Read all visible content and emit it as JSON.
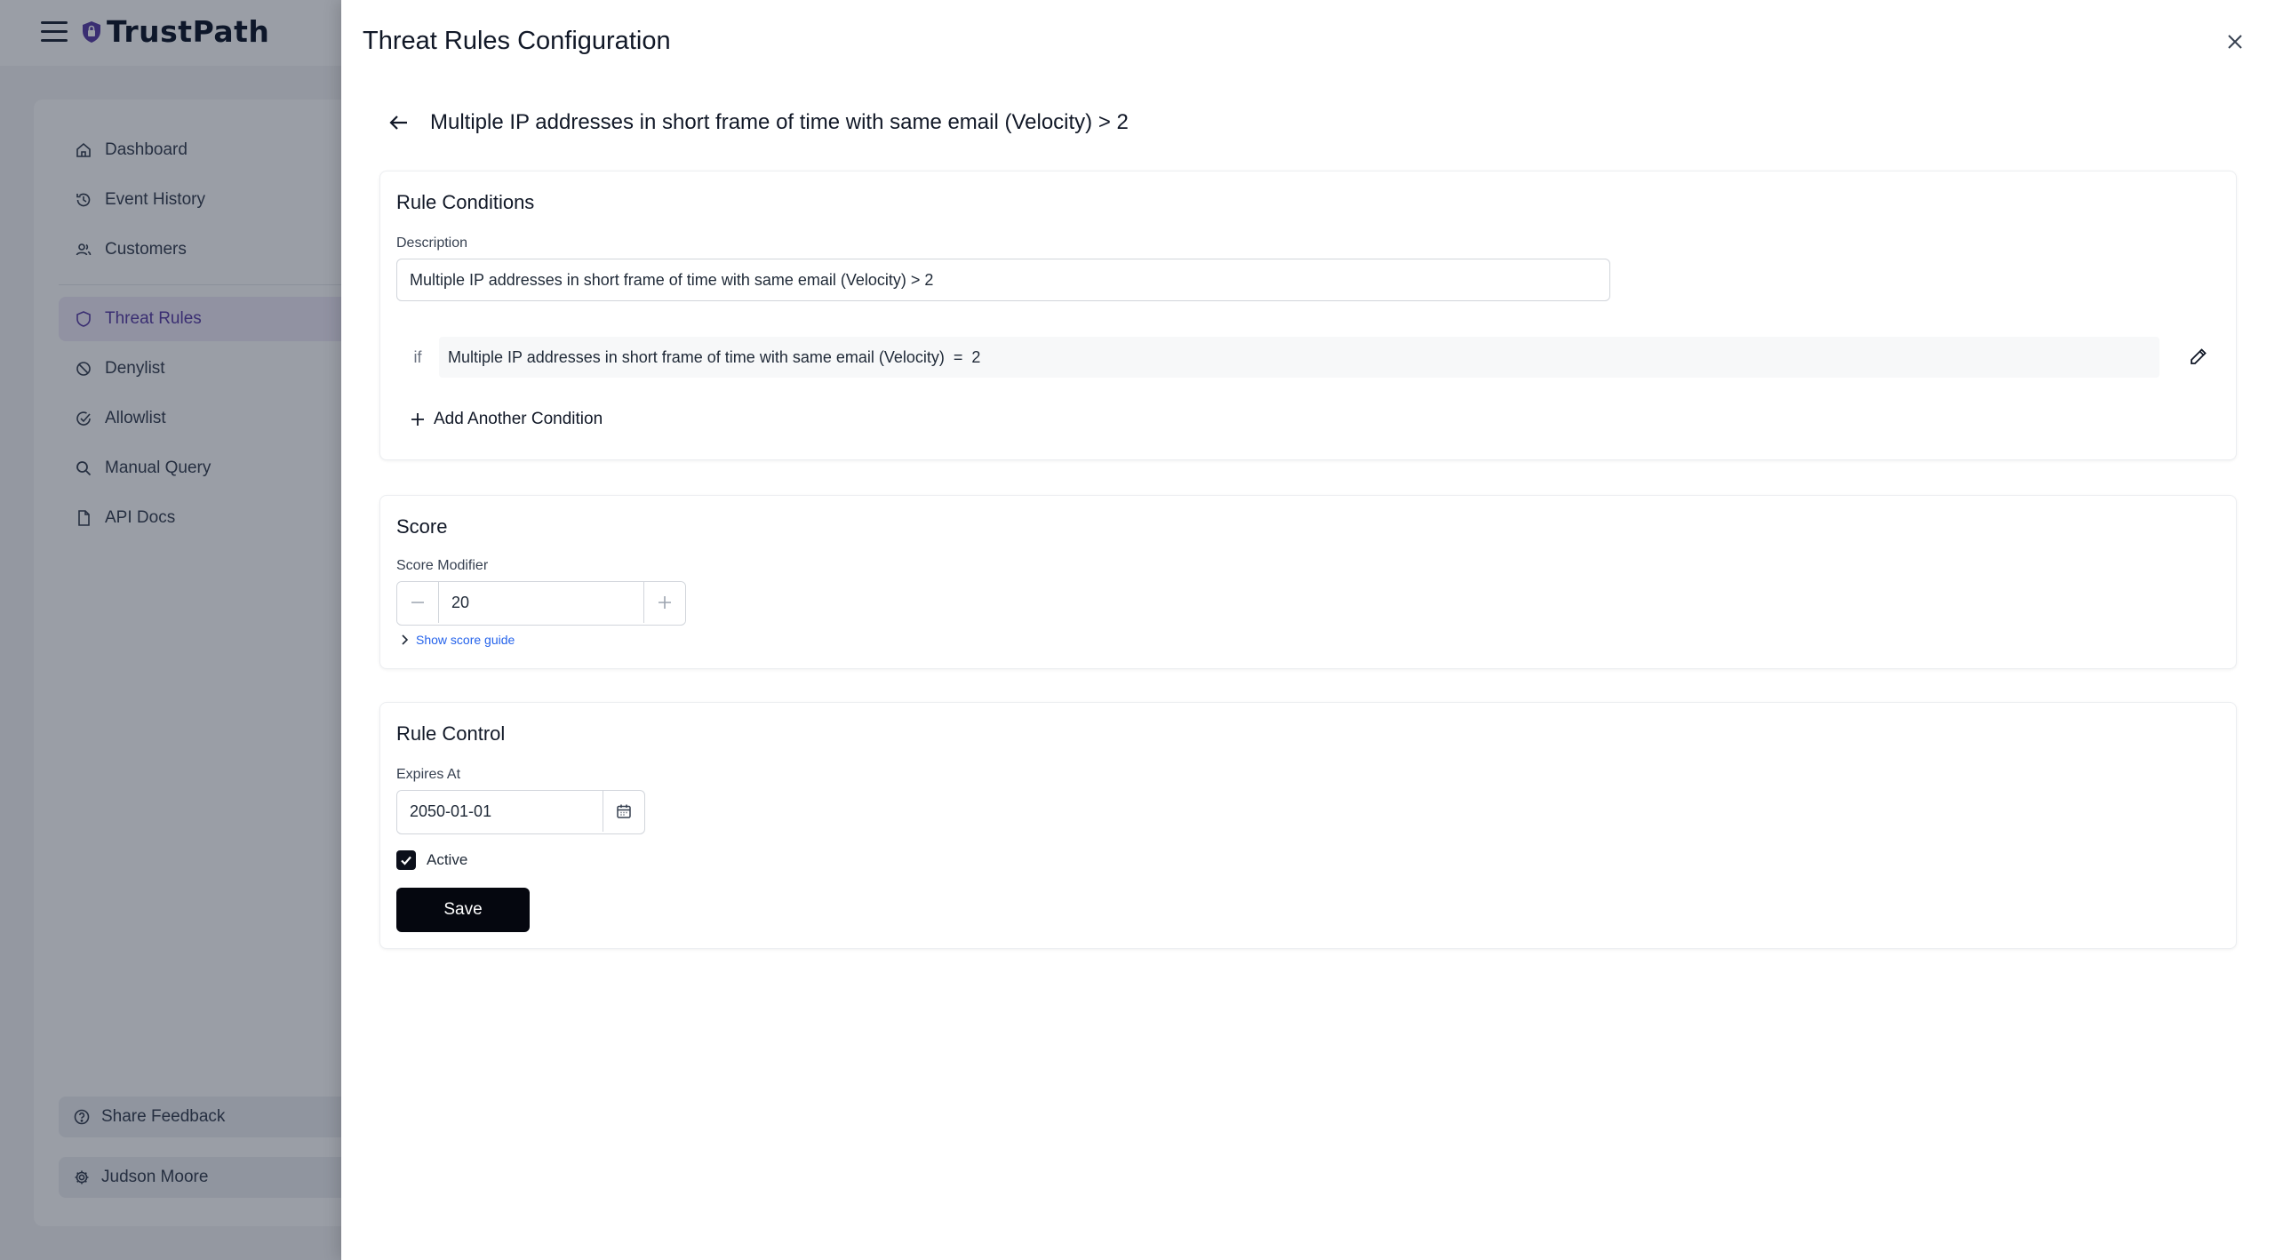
{
  "app": {
    "brand": "TrustPath",
    "sidebar": {
      "items": [
        {
          "label": "Dashboard",
          "icon": "home-icon"
        },
        {
          "label": "Event History",
          "icon": "history-icon"
        },
        {
          "label": "Customers",
          "icon": "users-icon"
        },
        {
          "label": "Threat Rules",
          "icon": "shield-icon",
          "active": true
        },
        {
          "label": "Denylist",
          "icon": "ban-icon"
        },
        {
          "label": "Allowlist",
          "icon": "check-circle-icon"
        },
        {
          "label": "Manual Query",
          "icon": "search-icon"
        },
        {
          "label": "API Docs",
          "icon": "file-icon",
          "external": true
        }
      ],
      "share_feedback": "Share Feedback",
      "user_name": "Judson Moore"
    }
  },
  "drawer": {
    "title": "Threat Rules Configuration",
    "rule_heading": "Multiple IP addresses in short frame of time with same email (Velocity) > 2",
    "conditions_card": {
      "title": "Rule Conditions",
      "description_label": "Description",
      "description_value": "Multiple IP addresses in short frame of time with same email (Velocity) > 2",
      "condition": {
        "prefix": "if",
        "field": "Multiple IP addresses in short frame of time with same email (Velocity)",
        "operator": "=",
        "value": "2"
      },
      "add_condition_label": "Add Another Condition"
    },
    "score_card": {
      "title": "Score",
      "modifier_label": "Score Modifier",
      "modifier_value": "20",
      "guide_link": "Show score guide"
    },
    "control_card": {
      "title": "Rule Control",
      "expires_label": "Expires At",
      "expires_value": "2050-01-01",
      "active_label": "Active",
      "active_checked": true,
      "save_label": "Save"
    }
  },
  "colors": {
    "accent": "#5b3fa6",
    "primary_button": "#05070f",
    "link": "#2563eb"
  }
}
